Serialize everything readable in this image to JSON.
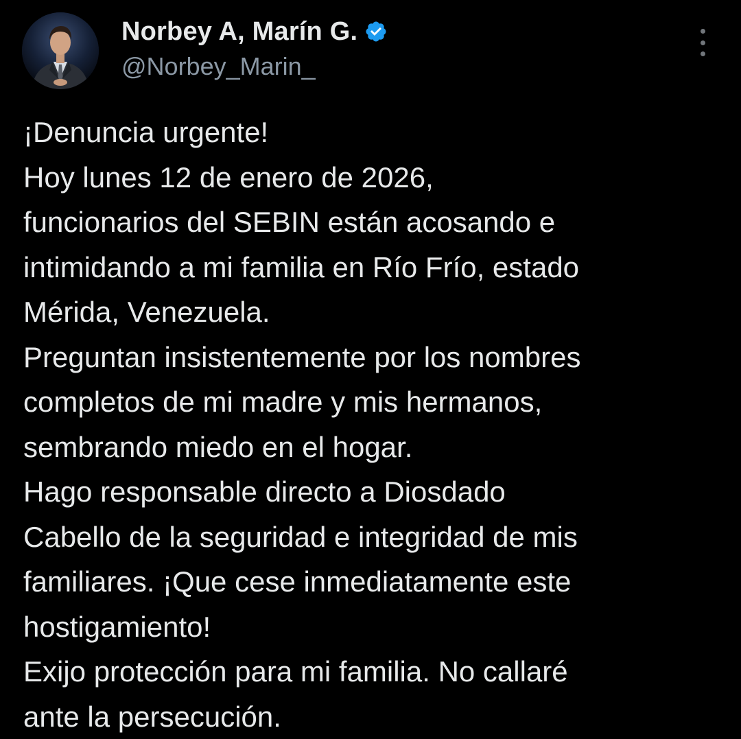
{
  "author": {
    "display_name": "Norbey A, Marín G.",
    "handle": "@Norbey_Marin_",
    "verified": true,
    "avatar": "profile-photo-man-in-suit",
    "verified_color": "#1d9bf0"
  },
  "tweet": {
    "lines": [
      "¡Denuncia urgente!",
      "Hoy lunes 12 de enero de 2026,",
      "funcionarios del SEBIN están acosando e",
      "intimidando a mi familia en Río Frío, estado",
      "Mérida, Venezuela.",
      "Preguntan insistentemente por los nombres",
      "completos de mi madre y mis hermanos,",
      "sembrando miedo en el hogar.",
      "Hago responsable directo a Diosdado",
      "Cabello de la seguridad e integridad de mis",
      "familiares. ¡Que cese inmediatamente este",
      "hostigamiento!",
      "Exijo protección para mi familia. No callaré",
      "ante la persecución."
    ]
  },
  "icons": {
    "more": "more-options-vertical-icon",
    "verified": "verified-badge-icon"
  },
  "colors": {
    "background": "#000000",
    "text": "#e7e9ea",
    "secondary_text": "#8b98a5",
    "accent": "#1d9bf0"
  }
}
